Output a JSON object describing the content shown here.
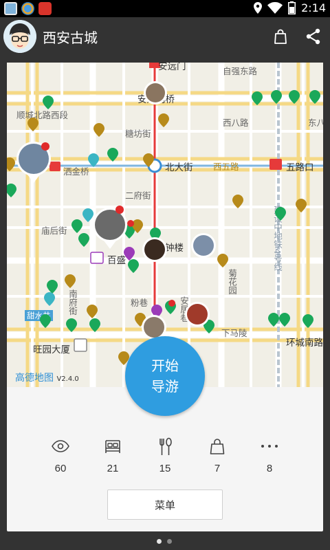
{
  "status_bar": {
    "time": "2:14"
  },
  "header": {
    "title": "西安古城",
    "bag_icon": "shopping-bag-icon",
    "share_icon": "share-icon"
  },
  "map": {
    "labels": {
      "anyuanmen": "安远门",
      "ziqiang": "自强东路",
      "anyuanmen_bridge": "安远门桥",
      "shuncheng": "顺城北路西段",
      "tangfang": "糖坊街",
      "xibalu": "西八路",
      "dong": "东八",
      "sajinqiao": "洒金桥",
      "beidajie": "北大街",
      "xiwulu": "西五路",
      "wuluk": "五路口",
      "erfujie": "二府街",
      "miaohou": "庙后街",
      "zhonglou": "钟楼",
      "baisheng": "百盛",
      "fenxiang": "粉巷",
      "juhuayuan": "菊花园",
      "ditie4": "建设中地铁4号线",
      "tianshuijing": "甜水井",
      "nanfujie": "南府街",
      "anjujie": "安居巷",
      "xiamaling": "下马陵",
      "huanchengnan": "环城南路",
      "wangyuan": "旺园大厦"
    },
    "watermark": "高德地图",
    "version": "V2.4.0"
  },
  "start_button": {
    "line1": "开始",
    "line2": "导游"
  },
  "categories": [
    {
      "icon": "eye-icon",
      "count": "60"
    },
    {
      "icon": "bed-icon",
      "count": "21"
    },
    {
      "icon": "fork-spoon-icon",
      "count": "15"
    },
    {
      "icon": "shopping-bag-icon",
      "count": "7"
    },
    {
      "icon": "more-icon",
      "count": "8"
    }
  ],
  "menu_button": {
    "label": "菜单"
  },
  "colors": {
    "accent_blue": "#2f9de0",
    "poi_green": "#1aa85a",
    "poi_gold": "#b78a1a",
    "metro_red": "#e63a3a",
    "metro_blue": "#3b8fd6"
  }
}
